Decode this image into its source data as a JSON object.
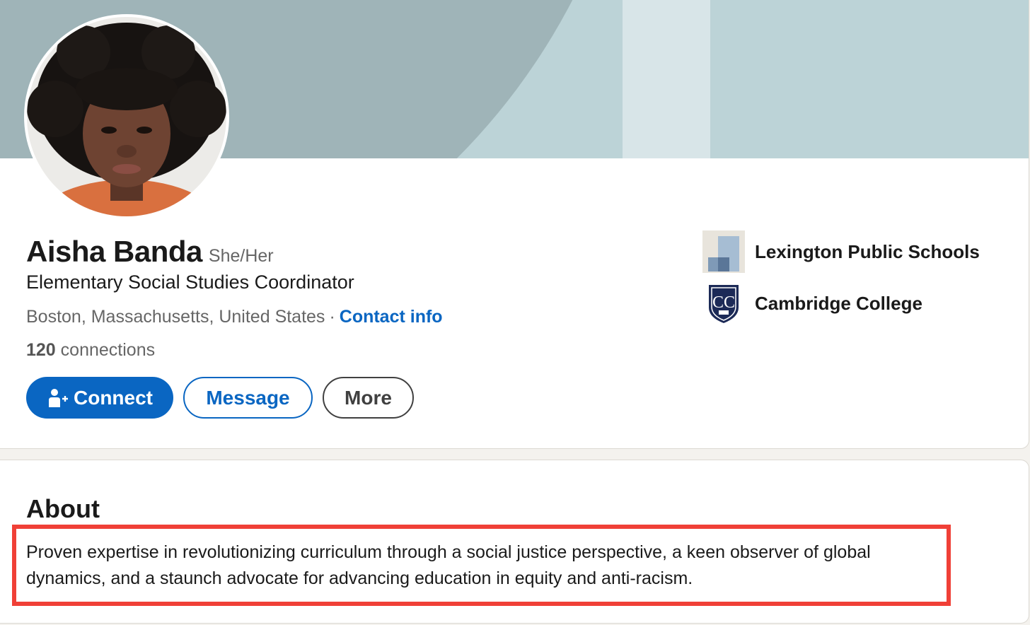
{
  "profile": {
    "name": "Aisha Banda",
    "pronouns": "She/Her",
    "headline": "Elementary Social Studies Coordinator",
    "location": "Boston, Massachusetts, United States",
    "separator": "·",
    "contact_link": "Contact info",
    "connections_count": "120",
    "connections_label": "connections"
  },
  "actions": {
    "connect_label": "Connect",
    "message_label": "Message",
    "more_label": "More"
  },
  "organizations": [
    {
      "name": "Lexington Public Schools",
      "icon": "lexington-logo-icon"
    },
    {
      "name": "Cambridge College",
      "icon": "cambridge-college-logo-icon",
      "logo_text": "CC"
    }
  ],
  "about": {
    "title": "About",
    "text": "Proven expertise in revolutionizing curriculum through a social justice perspective, a keen observer of global dynamics, and a staunch advocate for advancing education in equity and anti-racism."
  },
  "colors": {
    "brand_blue": "#0a66c2",
    "highlight_red": "#f04037",
    "banner_dark": "#9fb4b8",
    "banner_light": "#bcd3d7"
  }
}
